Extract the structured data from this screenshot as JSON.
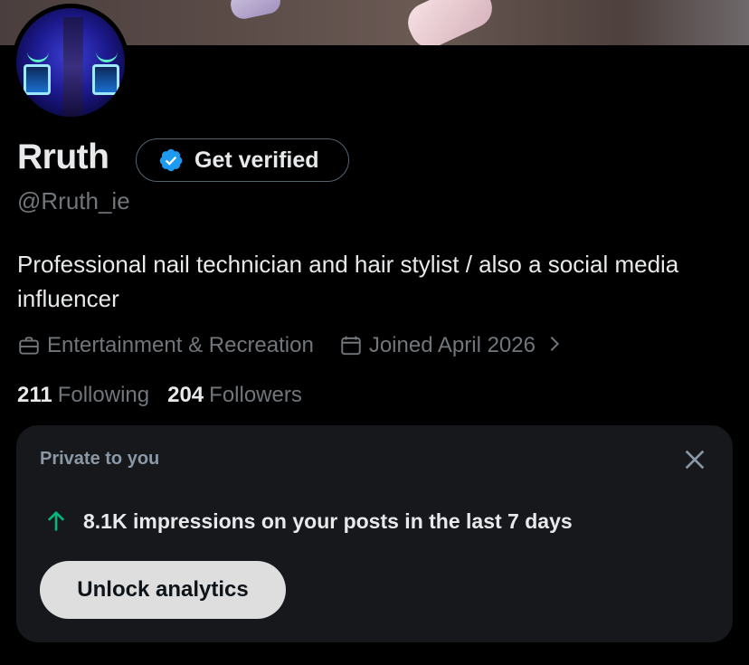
{
  "profile": {
    "name": "Rruth",
    "handle": "@Rruth_ie",
    "bio": "Professional nail technician and hair stylist / also a social media influencer",
    "category": "Entertainment & Recreation",
    "joined": "Joined April 2026",
    "following_count": "211",
    "following_label": "Following",
    "followers_count": "204",
    "followers_label": "Followers"
  },
  "verify_button": {
    "label": "Get verified"
  },
  "analytics_card": {
    "label": "Private to you",
    "stat": "8.1K impressions on your posts in the last 7 days",
    "button_label": "Unlock analytics"
  },
  "colors": {
    "background": "#000000",
    "card": "#16181c",
    "muted_text": "#71767b",
    "verified_blue": "#1d9bf0",
    "trend_green": "#00ba7c"
  },
  "icons": {
    "verified": "verified-badge-icon",
    "category": "briefcase-icon",
    "joined": "calendar-icon",
    "chevron": "chevron-right-icon",
    "close": "close-icon",
    "trend": "arrow-up-icon"
  }
}
